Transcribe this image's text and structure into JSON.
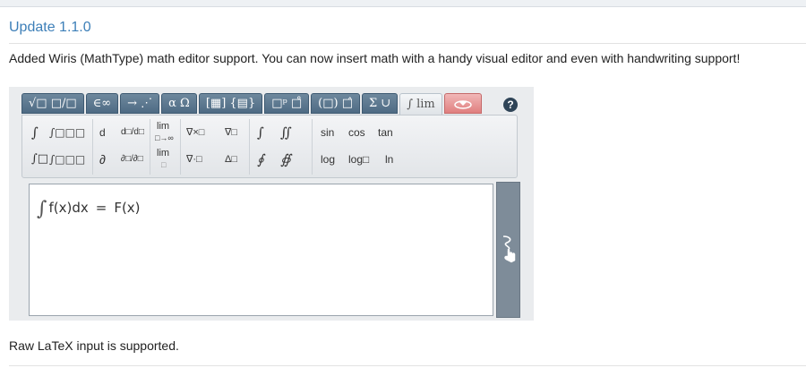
{
  "page": {
    "title": "Update 1.1.0",
    "description": "Added Wiris (MathType) math editor support. You can now insert math with a handy visual editor and even with handwriting support!",
    "footer": "Raw LaTeX input is supported."
  },
  "editor": {
    "tabs": [
      {
        "label": "√□ □/□",
        "icon": "radical-fraction-icon"
      },
      {
        "label": "∈∞",
        "icon": "symbols-icon"
      },
      {
        "label": "→ ⋰",
        "icon": "arrows-icon"
      },
      {
        "label": "α Ω",
        "icon": "greek-icon"
      },
      {
        "label": "[▦] {▤}",
        "icon": "matrix-icon"
      },
      {
        "label": "□ᵖ □̊",
        "icon": "scripts-icon"
      },
      {
        "label": "(□) □̂",
        "icon": "brackets-icon"
      },
      {
        "label": "Σ ∪",
        "icon": "big-operators-icon"
      },
      {
        "label": "∫ lim",
        "icon": "calculus-icon"
      },
      {
        "label": "",
        "icon": "handwriting-tab-icon"
      }
    ],
    "help_label": "?",
    "toolbar": {
      "row1": [
        "∫",
        "∫□□□",
        "d",
        "d□/d□",
        "lim",
        "□→∞",
        "∇×□",
        "∇□",
        "∫",
        "∬",
        "sin",
        "cos",
        "tan"
      ],
      "row2": [
        "∫□",
        "∫□□□",
        "∂",
        "∂□/∂□",
        "lim",
        "□",
        "∇·□",
        "Δ□",
        "∮",
        "∯",
        "log",
        "log□",
        "ln"
      ]
    },
    "formula": {
      "left": "f(x)dx",
      "eq": "=",
      "right": "F(x)"
    }
  },
  "colors": {
    "title": "#3d7fb8",
    "tab": "#5a7590",
    "hand_panel": "#7e8c99"
  }
}
